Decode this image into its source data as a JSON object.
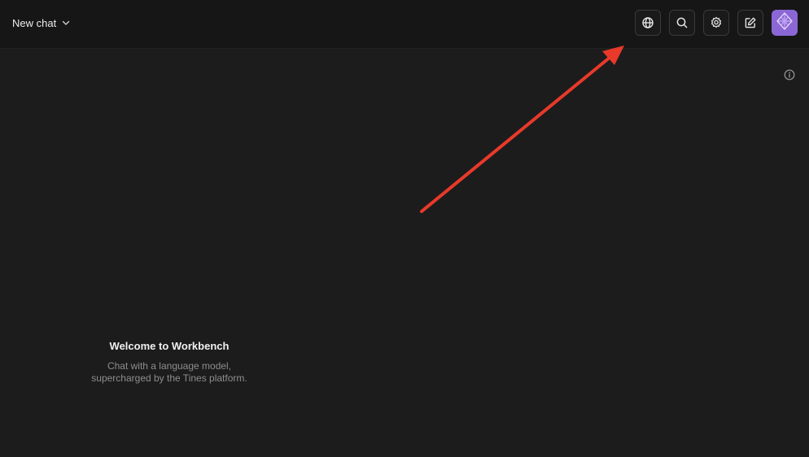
{
  "header": {
    "chat_title": "New chat",
    "buttons": [
      {
        "name": "globe-button",
        "icon": "globe-icon"
      },
      {
        "name": "search-button",
        "icon": "search-icon"
      },
      {
        "name": "settings-button",
        "icon": "gear-icon"
      },
      {
        "name": "new-chat-button",
        "icon": "edit-icon"
      }
    ],
    "avatar_icon": "diamond-logo-icon"
  },
  "info_icon": "info-icon",
  "welcome": {
    "title": "Welcome to Workbench",
    "subtitle_line1": "Chat with a language model,",
    "subtitle_line2": "supercharged by the Tines platform."
  },
  "colors": {
    "background": "#1c1c1c",
    "header": "#161616",
    "avatar": "#8b67d6",
    "arrow": "#e8392a",
    "muted_text": "#8d8d8d"
  }
}
